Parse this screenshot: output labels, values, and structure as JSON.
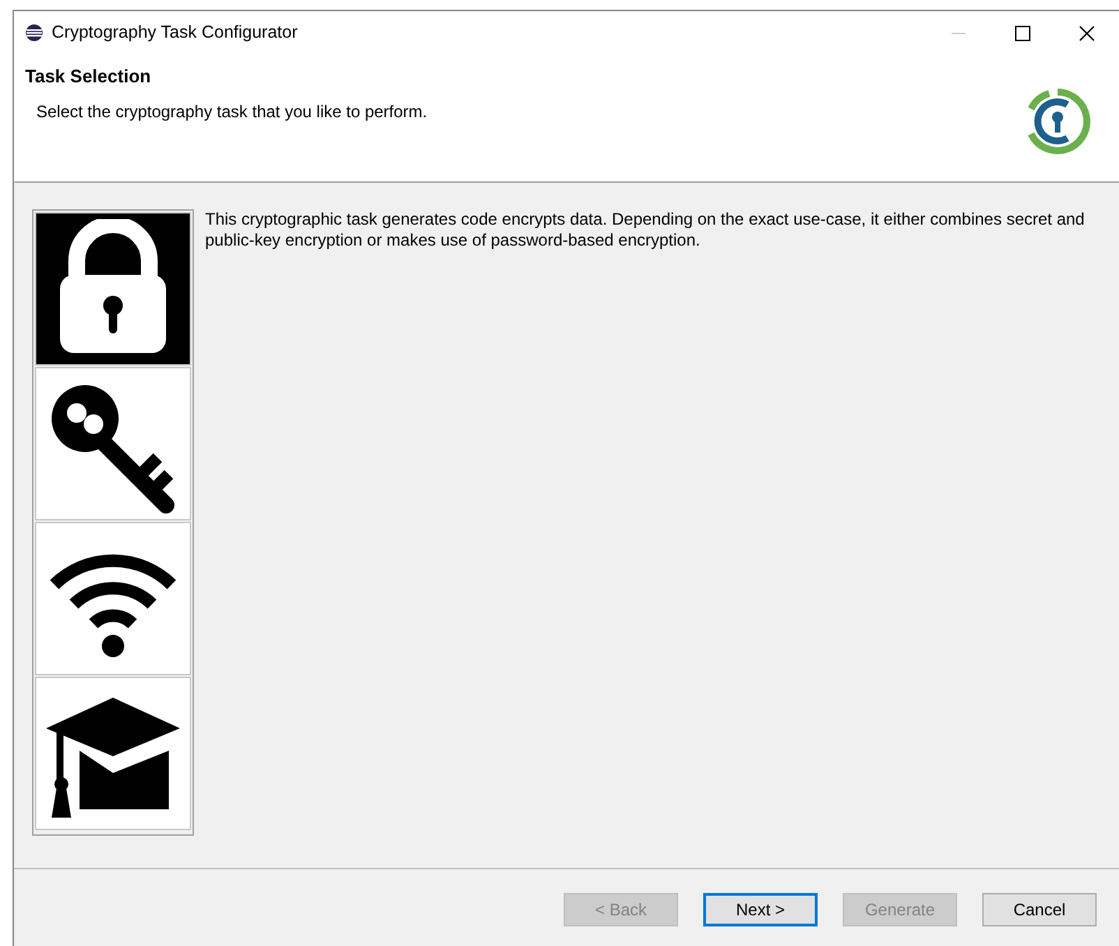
{
  "window": {
    "title": "Cryptography Task Configurator"
  },
  "header": {
    "title": "Task Selection",
    "description": "Select the cryptography task that you like to perform."
  },
  "tasks": [
    {
      "kind": "lock",
      "selected": true
    },
    {
      "kind": "key",
      "selected": false
    },
    {
      "kind": "wifi",
      "selected": false
    },
    {
      "kind": "graduation",
      "selected": false
    }
  ],
  "task_description": "This cryptographic task generates code encrypts data. Depending on the exact use-case, it either combines secret and public-key encryption or makes use of password-based encryption.",
  "buttons": [
    {
      "label": "< Back",
      "disabled": true,
      "focused": false
    },
    {
      "label": "Next >",
      "disabled": false,
      "focused": true
    },
    {
      "label": "Generate",
      "disabled": true,
      "focused": false
    },
    {
      "label": "Cancel",
      "disabled": false,
      "focused": false
    }
  ]
}
